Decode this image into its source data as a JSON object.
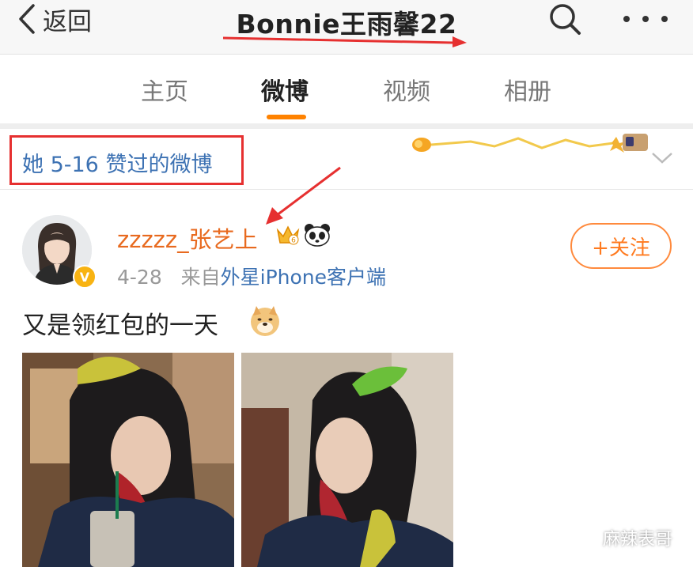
{
  "navbar": {
    "back_label": "返回",
    "title": "Bonnie王雨馨22"
  },
  "tabs": [
    {
      "label": "主页",
      "active": false
    },
    {
      "label": "微博",
      "active": true
    },
    {
      "label": "视频",
      "active": false
    },
    {
      "label": "相册",
      "active": false
    }
  ],
  "liked_header": {
    "text": "她 5-16 赞过的微博"
  },
  "post": {
    "username": "zzzzz_张艺上",
    "date": "4-28",
    "source_prefix": "来自",
    "source": "外星iPhone客户端",
    "follow_label": "+关注",
    "text": "又是领红包的一天",
    "verified_badge": "V"
  },
  "watermark": {
    "text": "麻辣表哥"
  },
  "colors": {
    "accent": "#ff8200",
    "username": "#e86a1f",
    "link": "#3d72b3",
    "annotation": "#e63030"
  },
  "icons": [
    "chevron-left-icon",
    "search-icon",
    "more-icon",
    "chevron-down-icon",
    "crown-icon",
    "panda-icon",
    "doge-emoji-icon",
    "wechat-icon"
  ]
}
